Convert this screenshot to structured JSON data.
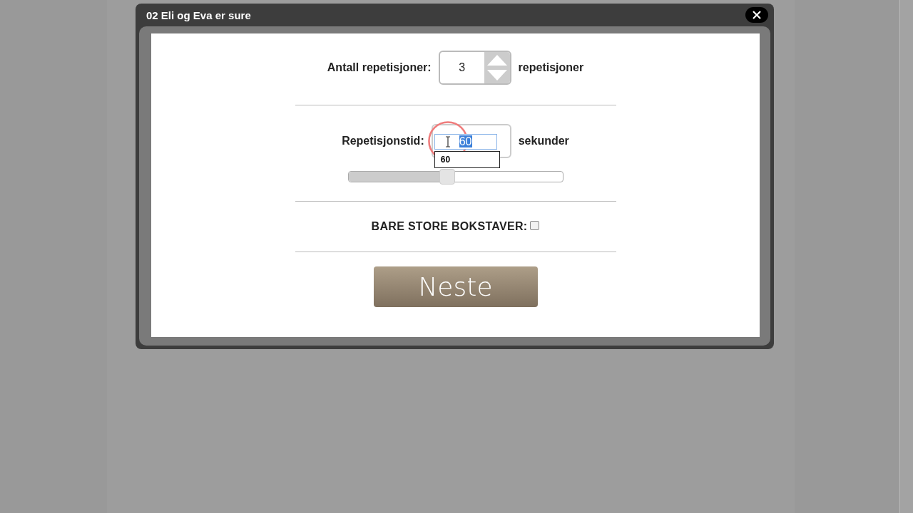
{
  "window": {
    "title": "02 Eli og Eva er sure"
  },
  "repetitions": {
    "label": "Antall repetisjoner:",
    "value": "3",
    "unit": "repetisjoner"
  },
  "duration": {
    "label": "Repetisjonstid:",
    "value": "60",
    "value_selected": true,
    "unit": "sekunder",
    "suggestions": [
      "60"
    ],
    "level": 0.46
  },
  "uppercase": {
    "label": "BARE STORE BOKSTAVER:",
    "checked": false
  },
  "next_button": {
    "label": "Neste"
  }
}
